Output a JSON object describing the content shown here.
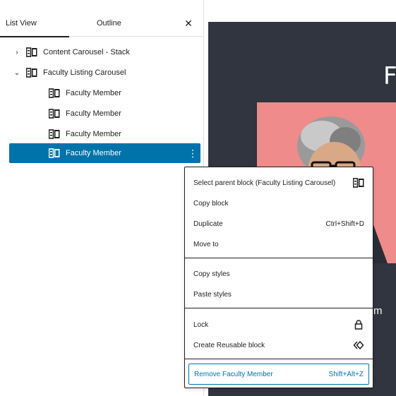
{
  "sidebar": {
    "tabs": [
      {
        "label": "List View",
        "active": true
      },
      {
        "label": "Outline",
        "active": false
      }
    ],
    "close_icon": "close-icon",
    "tree": [
      {
        "label": "Content Carousel - Stack",
        "level": 1,
        "expanded": false,
        "icon": "block-icon"
      },
      {
        "label": "Faculty Listing Carousel",
        "level": 1,
        "expanded": true,
        "icon": "block-icon"
      },
      {
        "label": "Faculty Member",
        "level": 2,
        "icon": "block-icon"
      },
      {
        "label": "Faculty Member",
        "level": 2,
        "icon": "block-icon"
      },
      {
        "label": "Faculty Member",
        "level": 2,
        "icon": "block-icon"
      },
      {
        "label": "Faculty Member",
        "level": 2,
        "icon": "block-icon",
        "selected": true
      }
    ]
  },
  "preview": {
    "big_letter": "F",
    "partial_text": "m",
    "photo_bg": "#ef8b8b"
  },
  "menu": {
    "groups": [
      [
        {
          "label": "Select parent block (Faculty Listing Carousel)",
          "icon": "block-icon"
        },
        {
          "label": "Copy block"
        },
        {
          "label": "Duplicate",
          "shortcut": "Ctrl+Shift+D"
        },
        {
          "label": "Move to"
        }
      ],
      [
        {
          "label": "Copy styles"
        },
        {
          "label": "Paste styles"
        }
      ],
      [
        {
          "label": "Lock",
          "icon": "lock-icon"
        },
        {
          "label": "Create Reusable block",
          "icon": "reusable-block-icon"
        }
      ],
      [
        {
          "label": "Remove Faculty Member",
          "shortcut": "Shift+Alt+Z"
        }
      ]
    ]
  },
  "colors": {
    "accent": "#0073aa",
    "canvas": "#30353f",
    "text": "#1e1e1e"
  }
}
